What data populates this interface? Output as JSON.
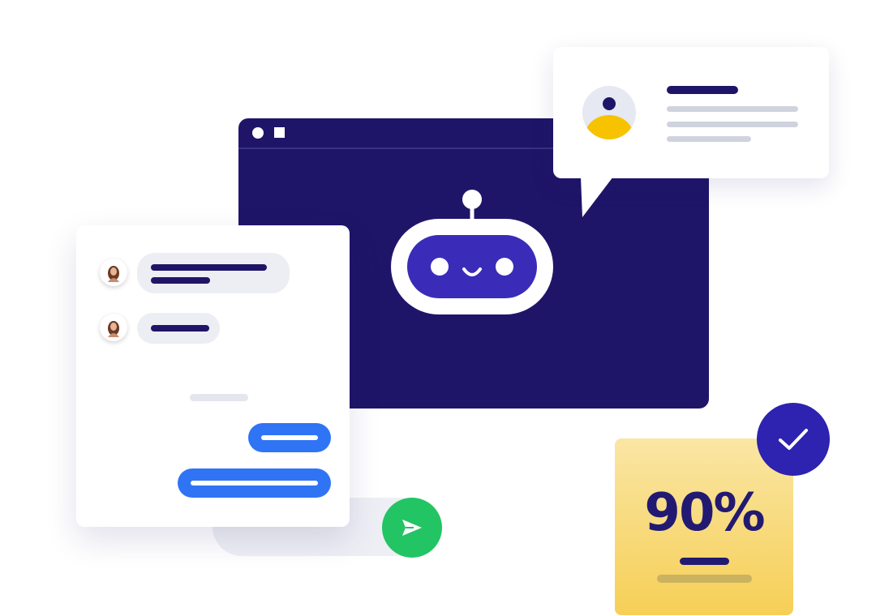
{
  "score": {
    "value": "90%",
    "verified": true
  },
  "icons": {
    "bot": "robot-face-icon",
    "send": "paper-plane-icon",
    "check": "checkmark-icon",
    "user": "user-avatar-icon"
  },
  "colors": {
    "navy": "#1f1568",
    "indigo": "#2e22b0",
    "blue": "#2f74f5",
    "green": "#23c463",
    "yellow": "#f6cf56"
  }
}
